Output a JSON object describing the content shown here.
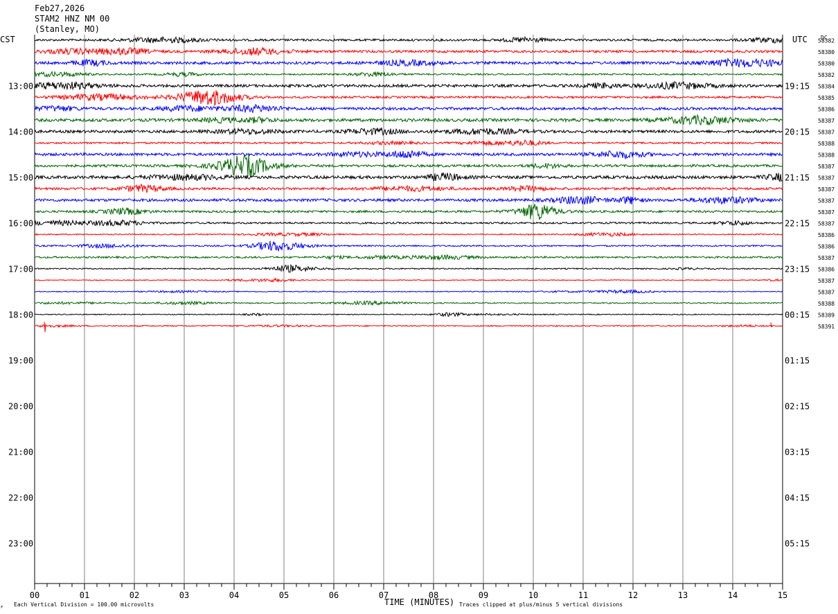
{
  "header": {
    "date": "Feb27,2026",
    "station": "STAM2 HNZ NM 00",
    "location": "(Stanley, MO)"
  },
  "labels": {
    "left_timezone": "CST",
    "right_timezone": "UTC",
    "dc_header": "DC",
    "x_axis_title": "TIME (MINUTES)",
    "scale_note": "Each Vertical Division =  100.00 microvolts",
    "clip_note": "Traces clipped at plus/minus 5 vertical divisions"
  },
  "colors": {
    "cycle": [
      "#000000",
      "#ff0000",
      "#0000ff",
      "#006400"
    ],
    "grid": "#808080"
  },
  "chart_data": {
    "type": "line",
    "x_range_minutes": [
      0,
      15
    ],
    "x_ticks": [
      "00",
      "01",
      "02",
      "03",
      "04",
      "05",
      "06",
      "07",
      "08",
      "09",
      "10",
      "11",
      "12",
      "13",
      "14",
      "15"
    ],
    "row_minutes": 15,
    "total_rows": 48,
    "hour_labels_cst": [
      "13:00",
      "14:00",
      "15:00",
      "16:00",
      "17:00",
      "18:00",
      "19:00",
      "20:00",
      "21:00",
      "22:00",
      "23:00"
    ],
    "hour_labels_utc": [
      "19:15",
      "20:15",
      "21:15",
      "22:15",
      "23:15",
      "00:15",
      "01:15",
      "02:15",
      "03:15",
      "04:15",
      "05:15"
    ],
    "trace_dc_offsets": [
      58382,
      58380,
      58380,
      58382,
      58384,
      58385,
      58386,
      58387,
      58387,
      58388,
      58388,
      58387,
      58387,
      58387,
      58387,
      58387,
      58387,
      58386,
      58386,
      58387,
      58386,
      58387,
      58387,
      58388,
      58389,
      58391
    ],
    "trace_amplitude_level": [
      0.7,
      0.8,
      0.9,
      0.5,
      0.9,
      0.7,
      0.9,
      1.0,
      0.9,
      0.6,
      0.9,
      0.8,
      1.0,
      0.8,
      0.9,
      0.7,
      0.6,
      0.4,
      0.5,
      0.6,
      0.4,
      0.3,
      0.3,
      0.4,
      0.3,
      0.4
    ],
    "grid": true,
    "scale": "Each Vertical Division = 100.00 microvolts",
    "clip": "Traces clipped at plus/minus 5 vertical divisions"
  }
}
